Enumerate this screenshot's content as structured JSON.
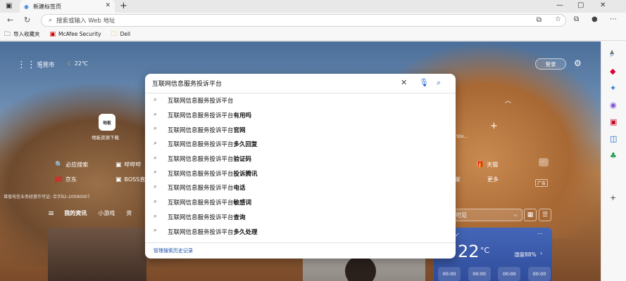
{
  "browser": {
    "tab_title": "新建标签页",
    "address_placeholder": "搜索或输入 Web 地址",
    "bookmarks": [
      {
        "icon": "folder-icon",
        "label": "导入收藏夹"
      },
      {
        "icon": "mcafee-icon",
        "label": "McAfee Security"
      },
      {
        "icon": "folder-icon",
        "label": "Dell"
      }
    ]
  },
  "page": {
    "city": "东莞市",
    "temperature": "22℃",
    "login_label": "登录",
    "tiles": [
      {
        "icon_text": "地板",
        "label": "地板资源下载"
      },
      {
        "label": "Sto..."
      }
    ],
    "quick_links": [
      {
        "icon": "🔍",
        "label": "必应搜索"
      },
      {
        "icon": "▣",
        "label": "哔哔哔"
      },
      {
        "icon": "JD",
        "label": "京东"
      },
      {
        "icon": "▣",
        "label": "BOSS直"
      },
      {
        "icon": "🎁",
        "label": "天猫"
      },
      {
        "icon": "",
        "label": "家"
      },
      {
        "icon": "",
        "label": "更多"
      }
    ],
    "ad_label": "广告",
    "footnote": "增值电信业务经营许可证: 合字B2-20090007",
    "news_tabs": [
      "我的资讯",
      "小游戏",
      "资"
    ],
    "visibility_label": "可见",
    "weather_card": {
      "temp": "22",
      "unit": "°C",
      "humidity": "湿度88%",
      "days": [
        "00:00",
        "00:00",
        "00:00",
        "00:00"
      ]
    }
  },
  "search": {
    "query": "互联网信息服务投诉平台",
    "suggestions": [
      {
        "base": "互联网信息服务投诉平台",
        "suffix": ""
      },
      {
        "base": "互联网信息服务投诉平台",
        "suffix": "有用吗"
      },
      {
        "base": "互联网信息服务投诉平台",
        "suffix": "官网"
      },
      {
        "base": "互联网信息服务投诉平台",
        "suffix": "多久回复"
      },
      {
        "base": "互联网信息服务投诉平台",
        "suffix": "验证码"
      },
      {
        "base": "互联网信息服务投诉平台",
        "suffix": "投诉腾讯"
      },
      {
        "base": "互联网信息服务投诉平台",
        "suffix": "电话"
      },
      {
        "base": "互联网信息服务投诉平台",
        "suffix": " 敏感词"
      },
      {
        "base": "互联网信息服务投诉平台",
        "suffix": "查询"
      },
      {
        "base": "互联网信息服务投诉平台",
        "suffix": "多久处理"
      }
    ],
    "manage_history": "管理搜索历史记录"
  }
}
